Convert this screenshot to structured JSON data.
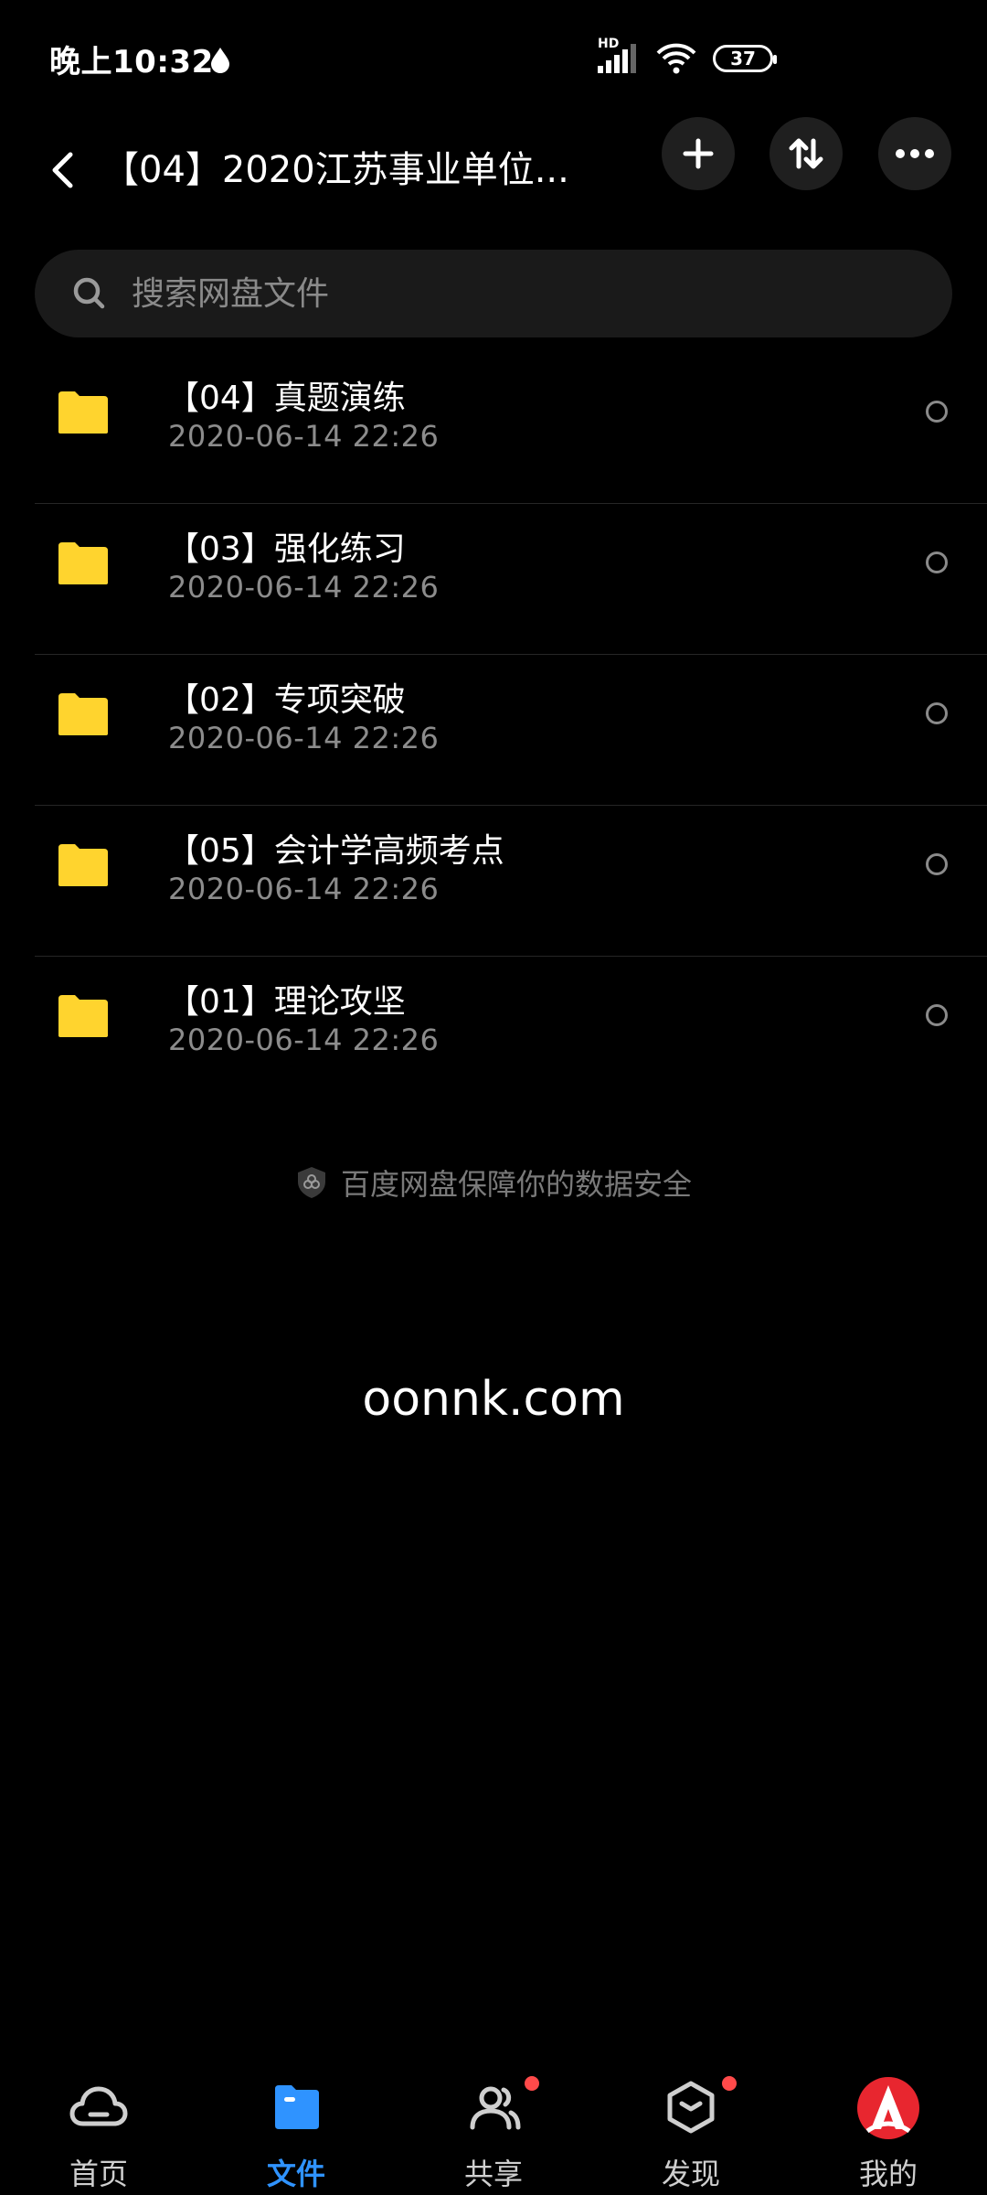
{
  "status_bar": {
    "time": "晚上10:32",
    "network_label": "HD",
    "battery": "37"
  },
  "header": {
    "title": "【04】2020江苏事业单位..."
  },
  "search": {
    "placeholder": "搜索网盘文件"
  },
  "files": [
    {
      "name": "【04】真题演练",
      "date": "2020-06-14  22:26"
    },
    {
      "name": "【03】强化练习",
      "date": "2020-06-14  22:26"
    },
    {
      "name": "【02】专项突破",
      "date": "2020-06-14  22:26"
    },
    {
      "name": "【05】会计学高频考点",
      "date": "2020-06-14  22:26"
    },
    {
      "name": "【01】理论攻坚",
      "date": "2020-06-14  22:26"
    }
  ],
  "security_note": "百度网盘保障你的数据安全",
  "watermark": "oonnk.com",
  "nav": {
    "home": "首页",
    "files": "文件",
    "share": "共享",
    "discover": "发现",
    "mine": "我的"
  },
  "colors": {
    "accent": "#2f93ff",
    "folder": "#ffd42e",
    "badge": "#ff4a4a"
  }
}
